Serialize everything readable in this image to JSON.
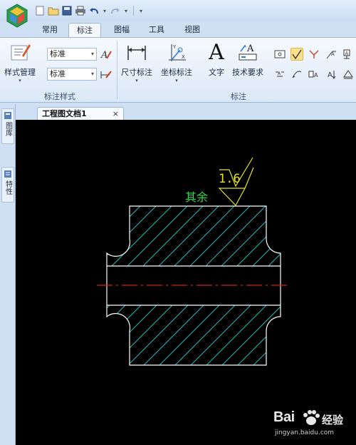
{
  "ribbon_tabs": [
    "常用",
    "标注",
    "图幅",
    "工具",
    "视图"
  ],
  "active_tab": "标注",
  "style_group": {
    "style_manager_label": "样式管理",
    "text_style_value": "标准",
    "dim_style_value": "标准",
    "group_label": "标注样式"
  },
  "annotate_group": {
    "dimension_label": "尺寸标注",
    "coordinate_label": "坐标标注",
    "text_label": "文字",
    "text_icon_glyph": "A",
    "tech_req_label": "技术要求",
    "group_label": "标注"
  },
  "document": {
    "tab_title": "工程图文档1",
    "close_glyph": "×"
  },
  "side_panels": [
    "图库",
    "特性"
  ],
  "drawing": {
    "roughness_value": "1.6",
    "remark_text": "其余",
    "hatch_color": "#2fb6b6",
    "outline_color": "#ffffff",
    "centerline_color": "#d22222",
    "annotation_color": "#e6e61a"
  },
  "watermark": {
    "brand": "Bai",
    "brand_suffix": "经验",
    "url": "jingyan.baidu.com"
  },
  "colors": {
    "ribbon_bg": "#dbe8f7",
    "accent_active": "#fbe08e"
  }
}
